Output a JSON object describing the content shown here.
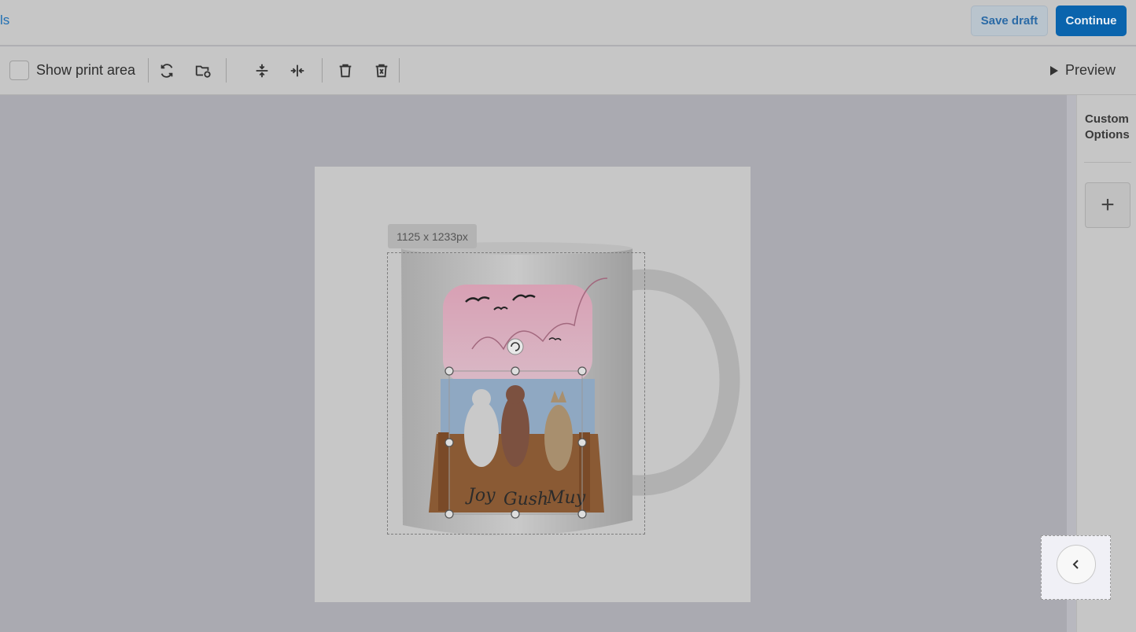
{
  "header": {
    "back_link": "ls",
    "save_draft": "Save draft",
    "continue": "Continue"
  },
  "toolbar": {
    "show_print_area": "Show print area",
    "preview": "Preview"
  },
  "canvas": {
    "dimension_label": "1125 x 1233px",
    "names": [
      "Joy",
      "Gush",
      "Muy"
    ]
  },
  "right_panel": {
    "title": "Custom Options",
    "add": "+"
  },
  "colors": {
    "primary": "#0a64ad",
    "save_text": "#2a6aa6"
  }
}
